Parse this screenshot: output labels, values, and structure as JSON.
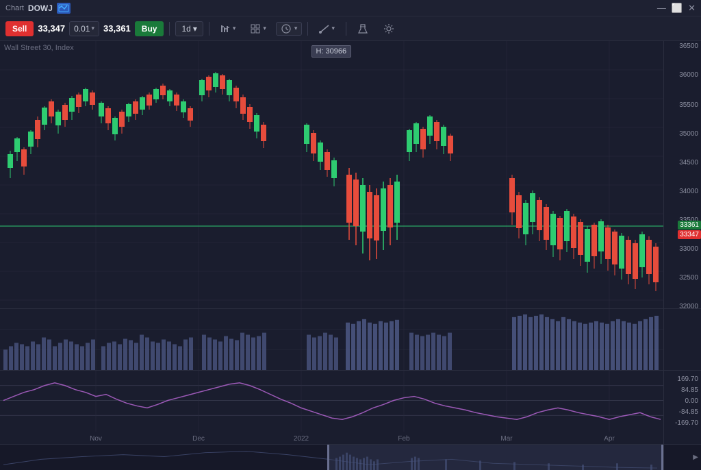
{
  "titleBar": {
    "chart_label": "Chart",
    "symbol": "DOWJ",
    "icon_text": "fx",
    "minimize": "—",
    "maximize": "⬜",
    "close": "✕"
  },
  "toolbar": {
    "sell_label": "Sell",
    "sell_price": "33,347",
    "spread": "0.01",
    "buy_price": "33,361",
    "buy_label": "Buy",
    "timeframe": "1d",
    "arrow_down": "▾"
  },
  "chart": {
    "info_line1": "Wall Street 30, Index",
    "tooltip_price": "H: 30966",
    "buy_line_price": "33361",
    "sell_line_price": "33347"
  },
  "yaxis": {
    "prices": [
      "36500",
      "36000",
      "35500",
      "35000",
      "34500",
      "34000",
      "33500",
      "33000",
      "32500"
    ],
    "buy_price": "33361",
    "sell_price": "33347"
  },
  "osc_yaxis": {
    "levels": [
      "169.70",
      "84.85",
      "0.00",
      "-84.85",
      "-169.70"
    ]
  },
  "xaxis": {
    "labels": [
      "Nov",
      "Dec",
      "2022",
      "Feb",
      "Mar",
      "Apr"
    ]
  }
}
